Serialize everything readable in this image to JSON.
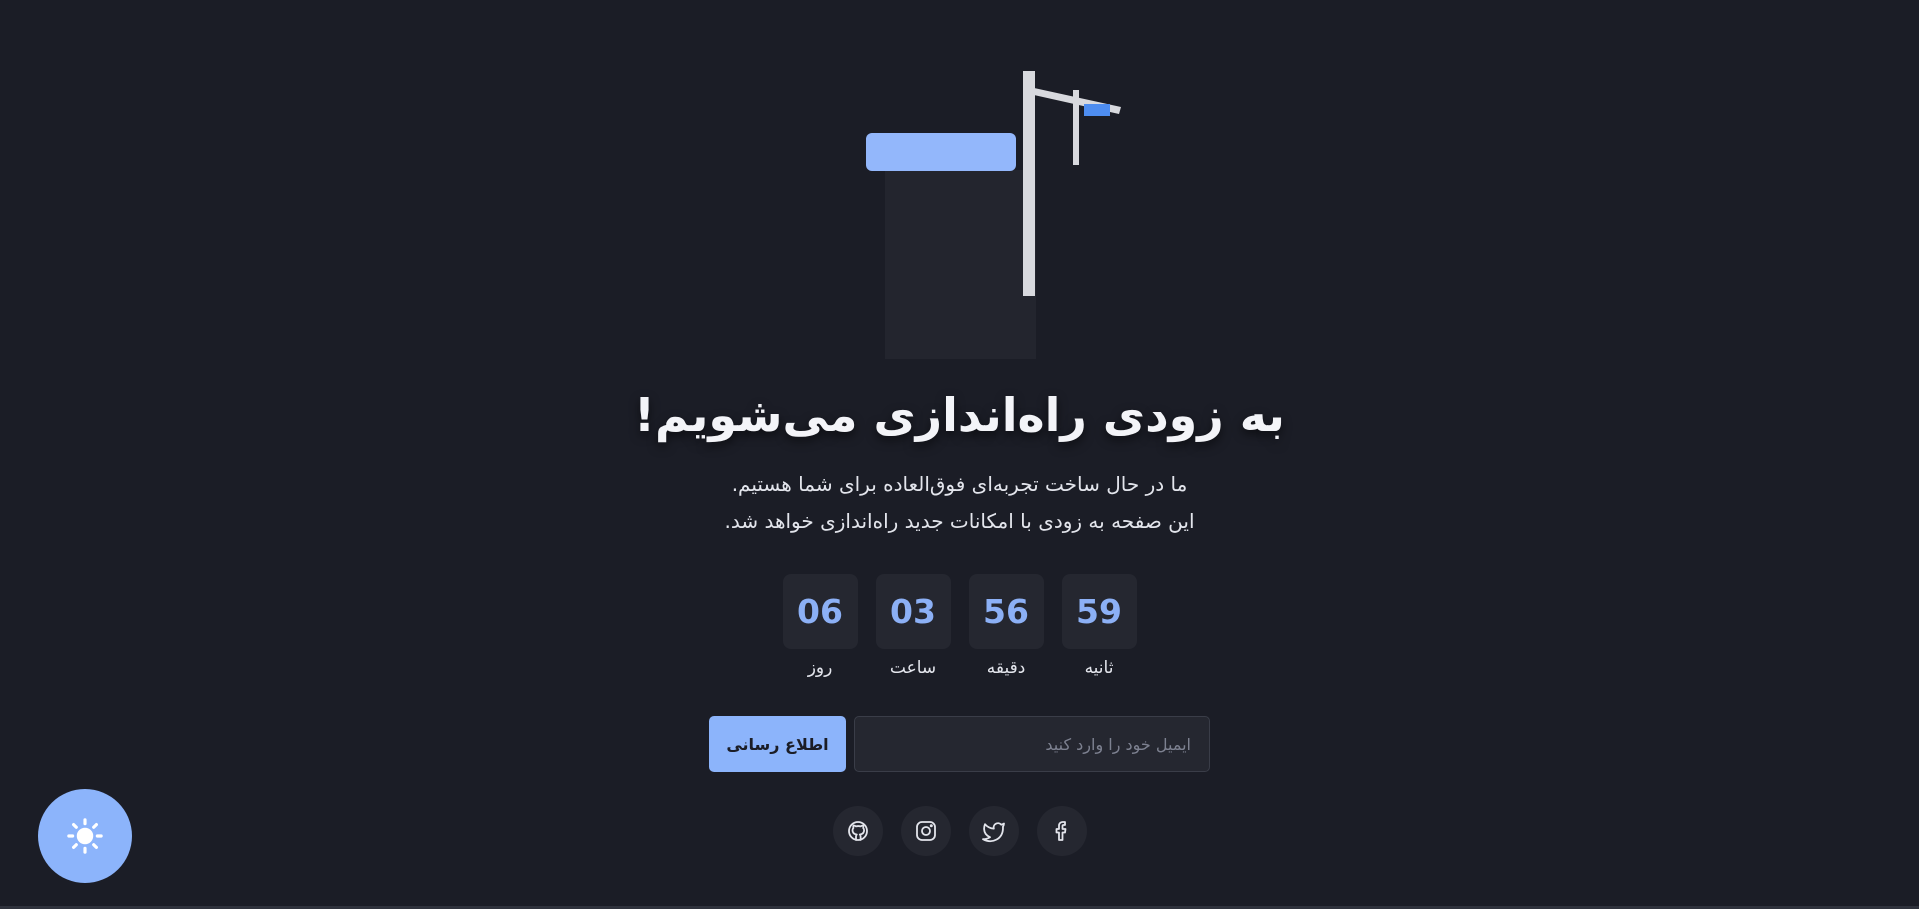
{
  "hero": {
    "title": "به زودی راه‌اندازی می‌شویم!",
    "description_line1": "ما در حال ساخت تجربه‌ای فوق‌العاده برای شما هستیم.",
    "description_line2": "این صفحه به زودی با امکانات جدید راه‌اندازی خواهد شد."
  },
  "countdown": {
    "units": [
      {
        "value": "59",
        "label": "ثانیه"
      },
      {
        "value": "56",
        "label": "دقیقه"
      },
      {
        "value": "03",
        "label": "ساعت"
      },
      {
        "value": "06",
        "label": "روز"
      }
    ]
  },
  "form": {
    "email_placeholder": "ایمیل خود را وارد کنید",
    "email_value": "",
    "submit_label": "اطلاع رسانی"
  },
  "social": {
    "icons": [
      "facebook-icon",
      "twitter-icon",
      "instagram-icon",
      "github-icon"
    ]
  },
  "theme_toggle": {
    "icon": "sun-icon"
  },
  "colors": {
    "background": "#1b1d26",
    "surface": "#252730",
    "accent": "#8cb4fb",
    "accent_text": "#8cb0f5",
    "text": "#e8e9ee",
    "illustration_pole": "#d8d9de",
    "illustration_cab": "#93b7fb"
  }
}
